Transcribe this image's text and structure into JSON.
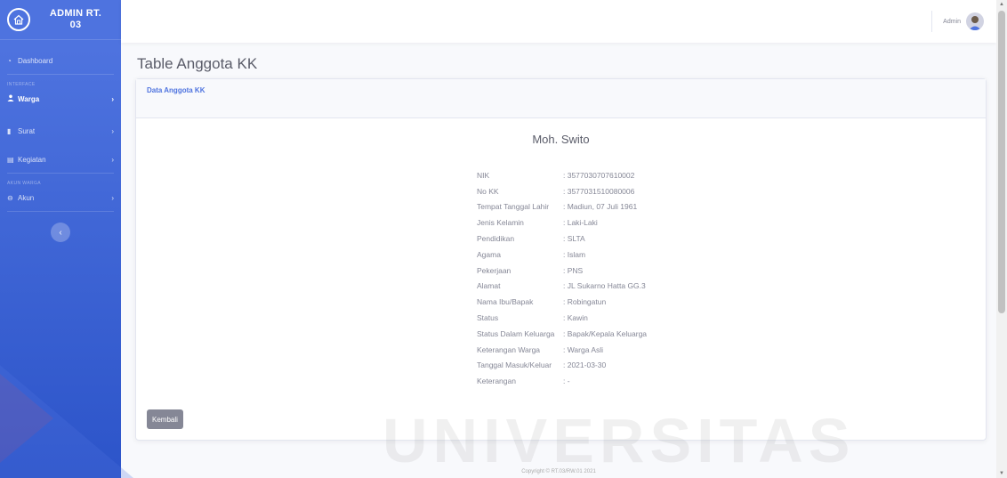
{
  "sidebar": {
    "brand": "ADMIN RT.\n03",
    "dashboard": "Dashboard",
    "heading_interface": "INTERFACE",
    "warga": "Warga",
    "surat": "Surat",
    "kegiatan": "Kegiatan",
    "heading_akun": "AKUN WARGA",
    "akun": "Akun",
    "toggle_icon": "chevron-left-icon"
  },
  "topbar": {
    "user_name": "Admin"
  },
  "page": {
    "title": "Table Anggota KK"
  },
  "card": {
    "header": "Data Anggota KK",
    "name": "Moh. Swito",
    "back_button": "Kembali"
  },
  "details": [
    {
      "label": "NIK",
      "value": ": 3577030707610002"
    },
    {
      "label": "No KK",
      "value": ": 3577031510080006"
    },
    {
      "label": "Tempat Tanggal Lahir",
      "value": ": Madiun, 07 Juli 1961"
    },
    {
      "label": "Jenis Kelamin",
      "value": ": Laki-Laki"
    },
    {
      "label": "Pendidikan",
      "value": ": SLTA"
    },
    {
      "label": "Agama",
      "value": ": Islam"
    },
    {
      "label": "Pekerjaan",
      "value": ": PNS"
    },
    {
      "label": "Alamat",
      "value": ": JL Sukarno Hatta GG.3"
    },
    {
      "label": "Nama Ibu/Bapak",
      "value": ": Robingatun"
    },
    {
      "label": "Status",
      "value": ": Kawin"
    },
    {
      "label": "Status Dalam Keluarga",
      "value": ": Bapak/Kepala Keluarga"
    },
    {
      "label": "Keterangan Warga",
      "value": ": Warga Asli"
    },
    {
      "label": "Tanggal Masuk/Keluar",
      "value": ": 2021-03-30"
    },
    {
      "label": "Keterangan",
      "value": ": -"
    }
  ],
  "footer": {
    "copyright": "Copyright © RT.03/RW.01 2021"
  },
  "watermark": {
    "text": "UNIVERSITAS"
  },
  "colors": {
    "primary": "#4e73df",
    "sidebar_dark": "#2c54c9",
    "muted": "#858796"
  }
}
